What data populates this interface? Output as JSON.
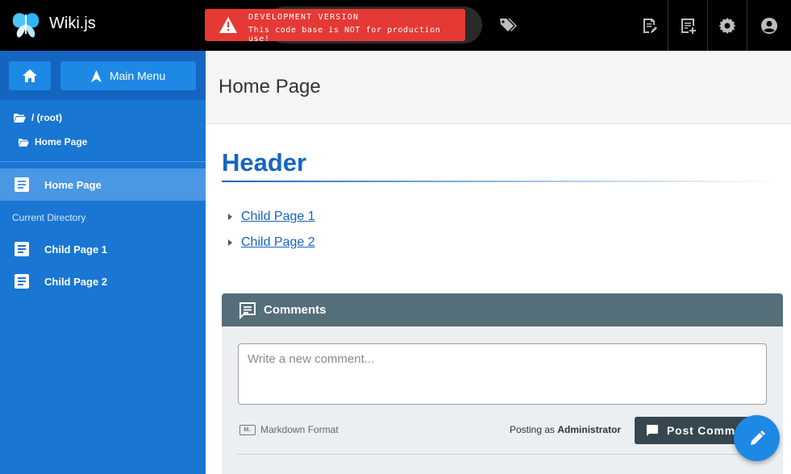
{
  "app": {
    "title": "Wiki.js"
  },
  "dev_banner": {
    "line1": "DEVELOPMENT VERSION",
    "line2": "This code base is NOT for production use!"
  },
  "topbar": {
    "icons": [
      "tag-icon",
      "page-actions-icon",
      "new-page-icon",
      "admin-gear-icon",
      "account-icon"
    ]
  },
  "sidebar": {
    "main_menu_label": "Main Menu",
    "breadcrumbs": [
      "/ (root)",
      "Home Page"
    ],
    "current_page": "Home Page",
    "subheader": "Current Directory",
    "children": [
      "Child Page 1",
      "Child Page 2"
    ]
  },
  "page": {
    "title": "Home Page",
    "header": "Header",
    "links": [
      "Child Page 1",
      "Child Page 2"
    ]
  },
  "comments": {
    "title": "Comments",
    "placeholder": "Write a new comment...",
    "format_label": "Markdown Format",
    "posting_as_prefix": "Posting as",
    "posting_as_user": "Administrator",
    "post_label": "Post Comment"
  },
  "colors": {
    "sidebar": "#1976d2",
    "accent": "#1565c0",
    "banner": "#e53935",
    "comments_header": "#546e7a"
  }
}
